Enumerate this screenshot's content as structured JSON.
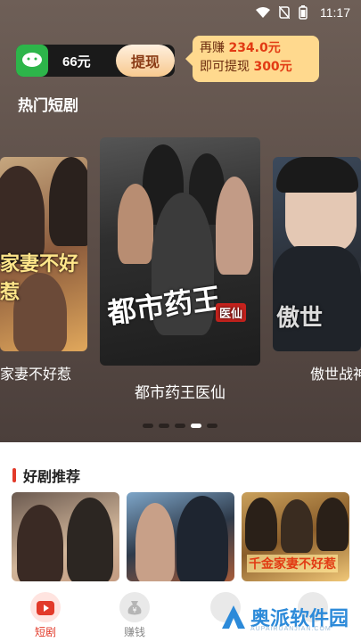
{
  "status_bar": {
    "time": "11:17"
  },
  "wallet": {
    "amount": "66元",
    "withdraw_label": "提现"
  },
  "tip": {
    "line1_prefix": "再赚 ",
    "line1_value": "234.0元",
    "line2_prefix": "即可提现 ",
    "line2_value": "300元"
  },
  "hot_section": {
    "title": "热门短剧"
  },
  "carousel": {
    "items": [
      {
        "caption": "家妻不好惹",
        "poster_text": "家妻不好惹"
      },
      {
        "caption": "都市药王医仙",
        "poster_text_main": "都市药王",
        "poster_text_sub": "医仙"
      },
      {
        "caption": "傲世战神",
        "poster_text": "傲世"
      }
    ],
    "page_count": 5,
    "active_index": 3
  },
  "recommend": {
    "title": "好剧推荐",
    "items": [
      {
        "poster_text": ""
      },
      {
        "poster_text": ""
      },
      {
        "poster_text": "千金家妻不好惹"
      }
    ]
  },
  "tabbar": {
    "items": [
      {
        "label": "短剧",
        "icon": "play-icon",
        "active": true
      },
      {
        "label": "赚钱",
        "icon": "money-bag-icon",
        "active": false
      }
    ]
  },
  "watermark": {
    "text": "奥派软件园",
    "sub": "AUPAIRUANJIAN.COM"
  },
  "colors": {
    "accent": "#e23a2a",
    "wechat": "#2db54a",
    "tip_bg": "#ffd98e"
  }
}
